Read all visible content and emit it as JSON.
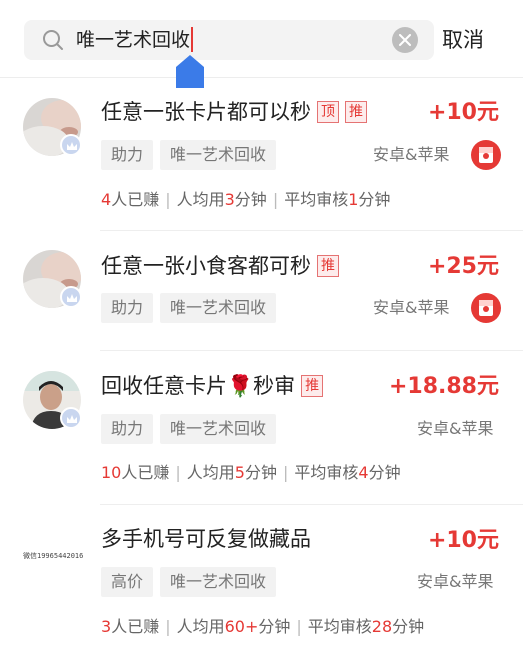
{
  "search": {
    "query": "唯一艺术回收",
    "cancel_label": "取消"
  },
  "items": [
    {
      "title": "任意一张卡片都可以秒",
      "tags": [
        "顶",
        "推"
      ],
      "reward": "+10元",
      "chips": [
        "助力",
        "唯一艺术回收"
      ],
      "platform": "安卓&苹果",
      "has_redpack": true,
      "stats": {
        "earned_num": "4",
        "earned_label": "人已赚",
        "avg_label": "人均用",
        "avg_num": "3",
        "avg_unit": "分钟",
        "review_label": "平均审核",
        "review_num": "1",
        "review_unit": "分钟"
      }
    },
    {
      "title": "任意一张小食客都可秒",
      "tags": [
        "推"
      ],
      "reward": "+25元",
      "chips": [
        "助力",
        "唯一艺术回收"
      ],
      "platform": "安卓&苹果",
      "has_redpack": true
    },
    {
      "title": "回收任意卡片🌹秒审",
      "tags": [
        "推"
      ],
      "reward": "+18.88元",
      "chips": [
        "助力",
        "唯一艺术回收"
      ],
      "platform": "安卓&苹果",
      "has_redpack": false,
      "stats": {
        "earned_num": "10",
        "earned_label": "人已赚",
        "avg_label": "人均用",
        "avg_num": "5",
        "avg_unit": "分钟",
        "review_label": "平均审核",
        "review_num": "4",
        "review_unit": "分钟"
      }
    },
    {
      "title": "多手机号可反复做藏品",
      "tags": [],
      "reward": "+10元",
      "chips": [
        "高价",
        "唯一艺术回收"
      ],
      "platform": "安卓&苹果",
      "has_redpack": false,
      "avatar_text": "微信19965442016",
      "stats": {
        "earned_num": "3",
        "earned_label": "人已赚",
        "avg_label": "人均用",
        "avg_num": "60+",
        "avg_unit": "分钟",
        "review_label": "平均审核",
        "review_num": "28",
        "review_unit": "分钟"
      }
    }
  ],
  "colors": {
    "accent": "#e53935",
    "handle": "#3b7be8",
    "badge": "#c9d6ef"
  }
}
